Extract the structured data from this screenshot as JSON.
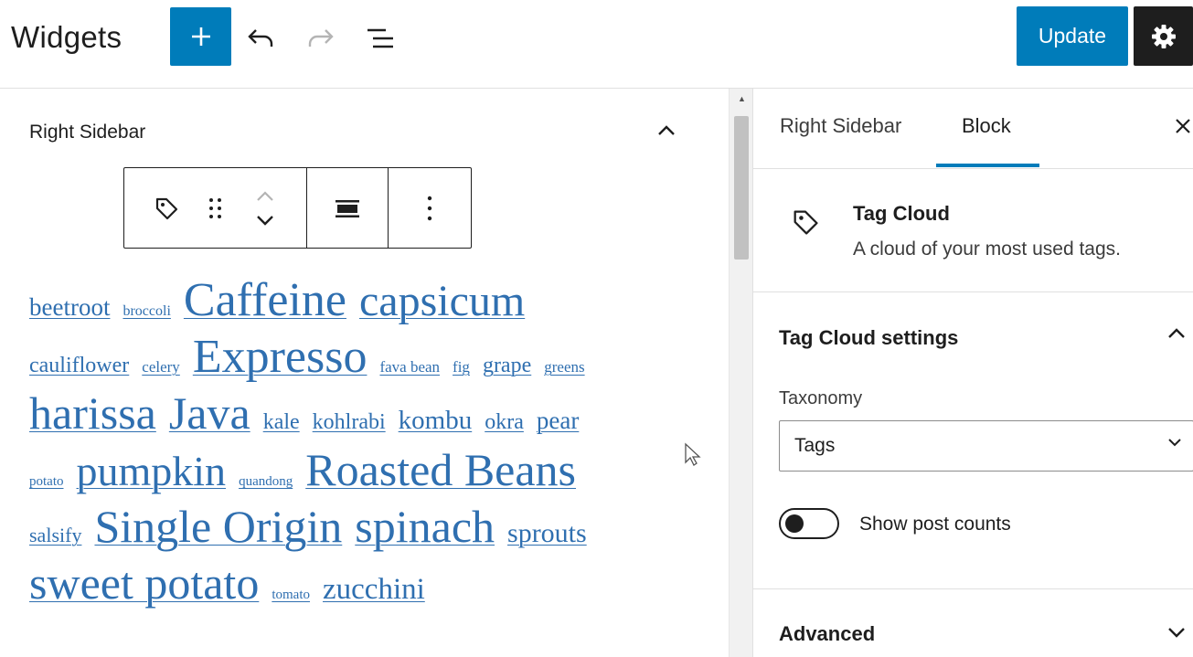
{
  "header": {
    "title": "Widgets",
    "update_label": "Update"
  },
  "editor": {
    "area_title": "Right Sidebar",
    "tags": [
      [
        {
          "t": "beetroot",
          "s": 27
        },
        {
          "t": "broccoli",
          "s": 16
        },
        {
          "t": "Caffeine",
          "s": 52
        },
        {
          "t": "capsicum",
          "s": 48
        }
      ],
      [
        {
          "t": "cauliflower",
          "s": 24
        },
        {
          "t": "celery",
          "s": 17
        },
        {
          "t": "Expresso",
          "s": 52
        },
        {
          "t": "fava bean",
          "s": 17
        },
        {
          "t": "fig",
          "s": 17
        },
        {
          "t": "grape",
          "s": 24
        },
        {
          "t": "greens",
          "s": 17
        }
      ],
      [
        {
          "t": "harissa",
          "s": 50
        },
        {
          "t": "Java",
          "s": 50
        },
        {
          "t": "kale",
          "s": 24
        },
        {
          "t": "kohlrabi",
          "s": 24
        },
        {
          "t": "kombu",
          "s": 29
        },
        {
          "t": "okra",
          "s": 24
        },
        {
          "t": "pear",
          "s": 27
        }
      ],
      [
        {
          "t": "potato",
          "s": 15
        },
        {
          "t": "pumpkin",
          "s": 46
        },
        {
          "t": "quandong",
          "s": 15
        },
        {
          "t": "Roasted Beans",
          "s": 50
        }
      ],
      [
        {
          "t": "salsify",
          "s": 22
        },
        {
          "t": "Single Origin",
          "s": 50
        },
        {
          "t": "spinach",
          "s": 50
        },
        {
          "t": "sprouts",
          "s": 30
        }
      ],
      [
        {
          "t": "sweet potato",
          "s": 50
        },
        {
          "t": "tomato",
          "s": 15
        },
        {
          "t": "zucchini",
          "s": 33
        }
      ]
    ]
  },
  "sidebar": {
    "tabs": [
      "Right Sidebar",
      "Block"
    ],
    "active_tab": "Block",
    "block": {
      "title": "Tag Cloud",
      "description": "A cloud of your most used tags."
    },
    "settings_panel": {
      "title": "Tag Cloud settings",
      "taxonomy_label": "Taxonomy",
      "taxonomy_value": "Tags",
      "show_post_counts_label": "Show post counts",
      "show_post_counts": false
    },
    "advanced_title": "Advanced"
  },
  "colors": {
    "accent": "#007cba",
    "link": "#2f6fb0",
    "dark": "#1e1e1e"
  }
}
